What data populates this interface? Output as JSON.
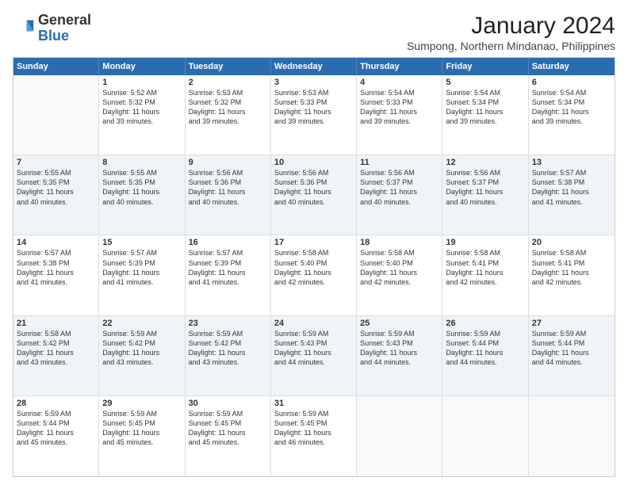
{
  "logo": {
    "line1": "General",
    "line2": "Blue"
  },
  "title": "January 2024",
  "subtitle": "Sumpong, Northern Mindanao, Philippines",
  "header_days": [
    "Sunday",
    "Monday",
    "Tuesday",
    "Wednesday",
    "Thursday",
    "Friday",
    "Saturday"
  ],
  "weeks": [
    [
      {
        "day": "",
        "info": ""
      },
      {
        "day": "1",
        "info": "Sunrise: 5:52 AM\nSunset: 5:32 PM\nDaylight: 11 hours\nand 39 minutes."
      },
      {
        "day": "2",
        "info": "Sunrise: 5:53 AM\nSunset: 5:32 PM\nDaylight: 11 hours\nand 39 minutes."
      },
      {
        "day": "3",
        "info": "Sunrise: 5:53 AM\nSunset: 5:33 PM\nDaylight: 11 hours\nand 39 minutes."
      },
      {
        "day": "4",
        "info": "Sunrise: 5:54 AM\nSunset: 5:33 PM\nDaylight: 11 hours\nand 39 minutes."
      },
      {
        "day": "5",
        "info": "Sunrise: 5:54 AM\nSunset: 5:34 PM\nDaylight: 11 hours\nand 39 minutes."
      },
      {
        "day": "6",
        "info": "Sunrise: 5:54 AM\nSunset: 5:34 PM\nDaylight: 11 hours\nand 39 minutes."
      }
    ],
    [
      {
        "day": "7",
        "info": "Sunrise: 5:55 AM\nSunset: 5:35 PM\nDaylight: 11 hours\nand 40 minutes."
      },
      {
        "day": "8",
        "info": "Sunrise: 5:55 AM\nSunset: 5:35 PM\nDaylight: 11 hours\nand 40 minutes."
      },
      {
        "day": "9",
        "info": "Sunrise: 5:56 AM\nSunset: 5:36 PM\nDaylight: 11 hours\nand 40 minutes."
      },
      {
        "day": "10",
        "info": "Sunrise: 5:56 AM\nSunset: 5:36 PM\nDaylight: 11 hours\nand 40 minutes."
      },
      {
        "day": "11",
        "info": "Sunrise: 5:56 AM\nSunset: 5:37 PM\nDaylight: 11 hours\nand 40 minutes."
      },
      {
        "day": "12",
        "info": "Sunrise: 5:56 AM\nSunset: 5:37 PM\nDaylight: 11 hours\nand 40 minutes."
      },
      {
        "day": "13",
        "info": "Sunrise: 5:57 AM\nSunset: 5:38 PM\nDaylight: 11 hours\nand 41 minutes."
      }
    ],
    [
      {
        "day": "14",
        "info": "Sunrise: 5:57 AM\nSunset: 5:38 PM\nDaylight: 11 hours\nand 41 minutes."
      },
      {
        "day": "15",
        "info": "Sunrise: 5:57 AM\nSunset: 5:39 PM\nDaylight: 11 hours\nand 41 minutes."
      },
      {
        "day": "16",
        "info": "Sunrise: 5:57 AM\nSunset: 5:39 PM\nDaylight: 11 hours\nand 41 minutes."
      },
      {
        "day": "17",
        "info": "Sunrise: 5:58 AM\nSunset: 5:40 PM\nDaylight: 11 hours\nand 42 minutes."
      },
      {
        "day": "18",
        "info": "Sunrise: 5:58 AM\nSunset: 5:40 PM\nDaylight: 11 hours\nand 42 minutes."
      },
      {
        "day": "19",
        "info": "Sunrise: 5:58 AM\nSunset: 5:41 PM\nDaylight: 11 hours\nand 42 minutes."
      },
      {
        "day": "20",
        "info": "Sunrise: 5:58 AM\nSunset: 5:41 PM\nDaylight: 11 hours\nand 42 minutes."
      }
    ],
    [
      {
        "day": "21",
        "info": "Sunrise: 5:58 AM\nSunset: 5:42 PM\nDaylight: 11 hours\nand 43 minutes."
      },
      {
        "day": "22",
        "info": "Sunrise: 5:59 AM\nSunset: 5:42 PM\nDaylight: 11 hours\nand 43 minutes."
      },
      {
        "day": "23",
        "info": "Sunrise: 5:59 AM\nSunset: 5:42 PM\nDaylight: 11 hours\nand 43 minutes."
      },
      {
        "day": "24",
        "info": "Sunrise: 5:59 AM\nSunset: 5:43 PM\nDaylight: 11 hours\nand 44 minutes."
      },
      {
        "day": "25",
        "info": "Sunrise: 5:59 AM\nSunset: 5:43 PM\nDaylight: 11 hours\nand 44 minutes."
      },
      {
        "day": "26",
        "info": "Sunrise: 5:59 AM\nSunset: 5:44 PM\nDaylight: 11 hours\nand 44 minutes."
      },
      {
        "day": "27",
        "info": "Sunrise: 5:59 AM\nSunset: 5:44 PM\nDaylight: 11 hours\nand 44 minutes."
      }
    ],
    [
      {
        "day": "28",
        "info": "Sunrise: 5:59 AM\nSunset: 5:44 PM\nDaylight: 11 hours\nand 45 minutes."
      },
      {
        "day": "29",
        "info": "Sunrise: 5:59 AM\nSunset: 5:45 PM\nDaylight: 11 hours\nand 45 minutes."
      },
      {
        "day": "30",
        "info": "Sunrise: 5:59 AM\nSunset: 5:45 PM\nDaylight: 11 hours\nand 45 minutes."
      },
      {
        "day": "31",
        "info": "Sunrise: 5:59 AM\nSunset: 5:45 PM\nDaylight: 11 hours\nand 46 minutes."
      },
      {
        "day": "",
        "info": ""
      },
      {
        "day": "",
        "info": ""
      },
      {
        "day": "",
        "info": ""
      }
    ]
  ]
}
